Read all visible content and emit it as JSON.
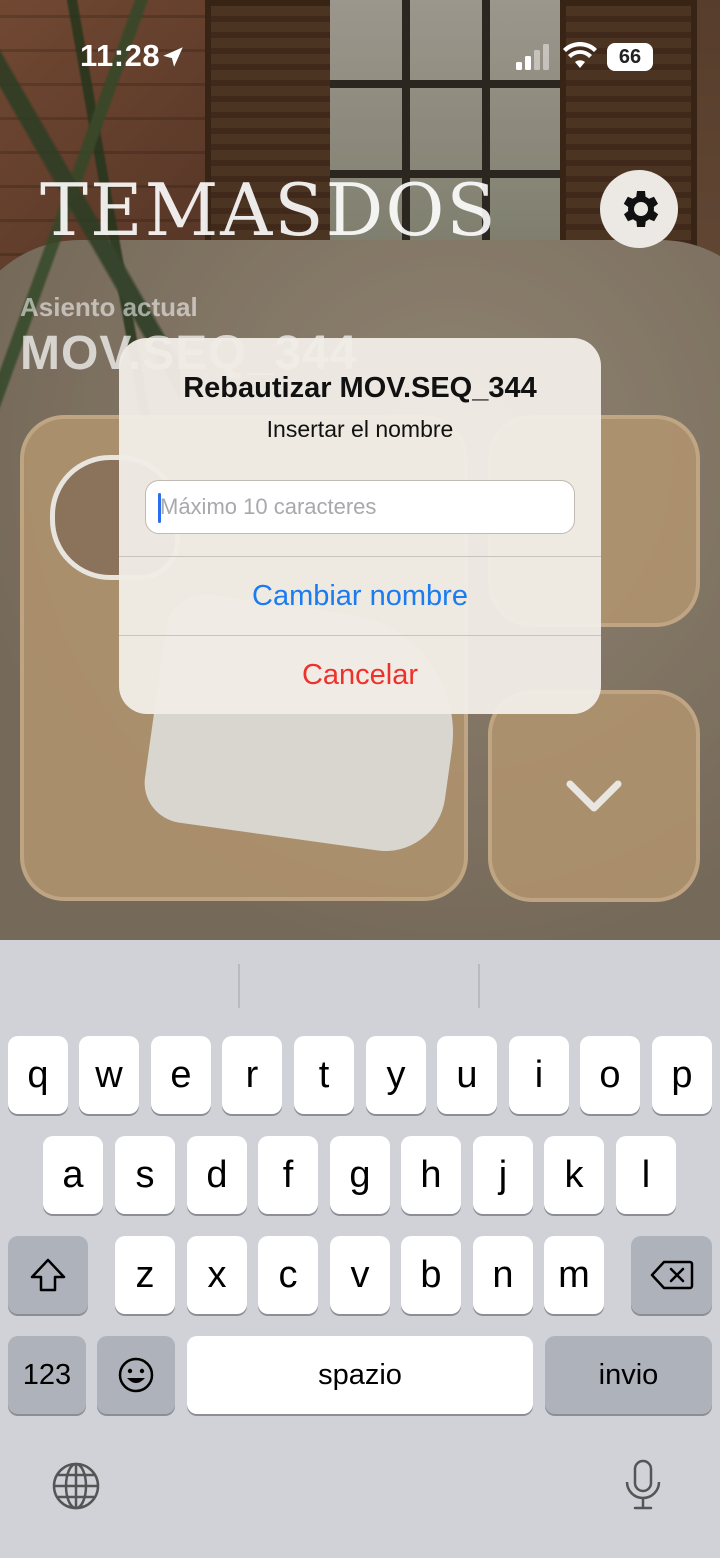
{
  "status_bar": {
    "time": "11:28",
    "battery": "66"
  },
  "app": {
    "logo": "TEMASDOS",
    "seat_label": "Asiento actual",
    "seat_value": "MOV.SEQ_344"
  },
  "dialog": {
    "title": "Rebautizar MOV.SEQ_344",
    "message": "Insertar el nombre",
    "input_placeholder": "Máximo 10 caracteres",
    "input_value": "",
    "confirm_label": "Cambiar nombre",
    "cancel_label": "Cancelar",
    "colors": {
      "confirm": "#1a7cf0",
      "cancel": "#f0302a"
    }
  },
  "keyboard": {
    "row1": [
      "q",
      "w",
      "e",
      "r",
      "t",
      "y",
      "u",
      "i",
      "o",
      "p"
    ],
    "row2": [
      "a",
      "s",
      "d",
      "f",
      "g",
      "h",
      "j",
      "k",
      "l"
    ],
    "row3": [
      "z",
      "x",
      "c",
      "v",
      "b",
      "n",
      "m"
    ],
    "numbers_label": "123",
    "space_label": "spazio",
    "return_label": "invio"
  }
}
